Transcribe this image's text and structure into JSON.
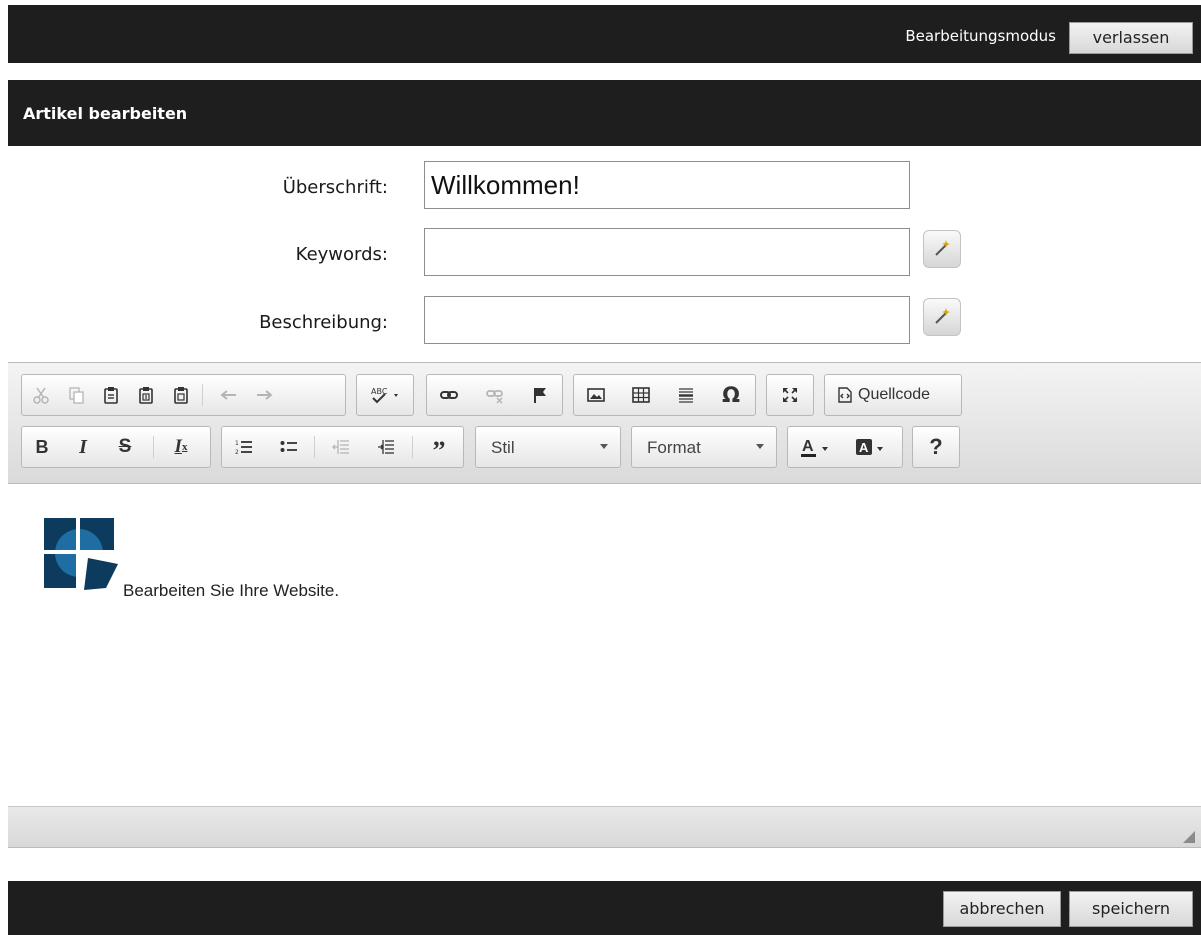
{
  "topbar": {
    "mode_label": "Bearbeitungsmodus",
    "exit_button": "verlassen"
  },
  "panel": {
    "title": "Artikel bearbeiten"
  },
  "form": {
    "heading_label": "Überschrift:",
    "heading_value": "Willkommen!",
    "keywords_label": "Keywords:",
    "keywords_value": "",
    "description_label": "Beschreibung:",
    "description_value": ""
  },
  "toolbar": {
    "source_button": "Quellcode",
    "style_combo": "Stil",
    "format_combo": "Format",
    "help_button": "?"
  },
  "editor": {
    "content_text": "Bearbeiten Sie Ihre Website."
  },
  "footer": {
    "cancel_button": "abbrechen",
    "save_button": "speichern"
  },
  "colors": {
    "dark_bar": "#1e1e1e",
    "logo_blue": "#0d3b5e",
    "logo_light": "#1e6ea3"
  }
}
